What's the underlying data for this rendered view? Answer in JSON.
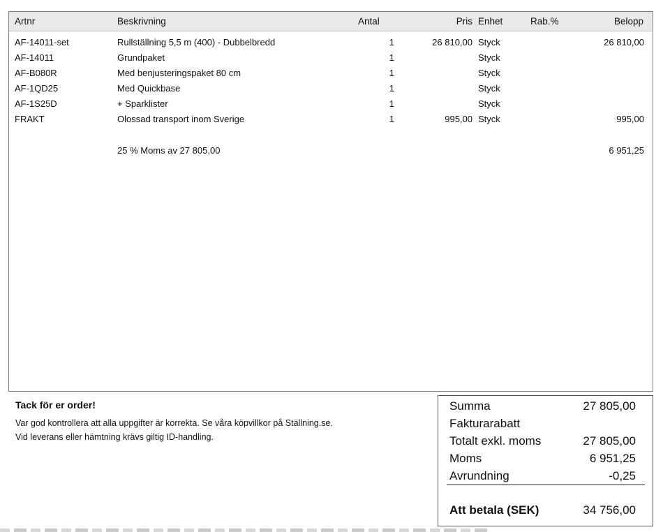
{
  "table": {
    "headers": {
      "artnr": "Artnr",
      "description": "Beskrivning",
      "quantity": "Antal",
      "price": "Pris",
      "unit": "Enhet",
      "discount": "Rab.%",
      "amount": "Belopp"
    },
    "rows": [
      {
        "artnr": "AF-14011-set",
        "description": "Rullställning 5,5 m (400) - Dubbelbredd",
        "quantity": "1",
        "price": "26 810,00",
        "unit": "Styck",
        "discount": "",
        "amount": "26 810,00"
      },
      {
        "artnr": "AF-14011",
        "description": "Grundpaket",
        "quantity": "1",
        "price": "",
        "unit": "Styck",
        "discount": "",
        "amount": ""
      },
      {
        "artnr": "AF-B080R",
        "description": "Med benjusteringspaket 80 cm",
        "quantity": "1",
        "price": "",
        "unit": "Styck",
        "discount": "",
        "amount": ""
      },
      {
        "artnr": "AF-1QD25",
        "description": "Med Quickbase",
        "quantity": "1",
        "price": "",
        "unit": "Styck",
        "discount": "",
        "amount": ""
      },
      {
        "artnr": "AF-1S25D",
        "description": "+ Sparklister",
        "quantity": "1",
        "price": "",
        "unit": "Styck",
        "discount": "",
        "amount": ""
      },
      {
        "artnr": "FRAKT",
        "description": "Olossad transport inom Sverige",
        "quantity": "1",
        "price": "995,00",
        "unit": "Styck",
        "discount": "",
        "amount": "995,00"
      }
    ],
    "vat_line": {
      "description": "25 % Moms av 27 805,00",
      "amount": "6 951,25"
    }
  },
  "message": {
    "title": "Tack för er order!",
    "lines": [
      "Var god kontrollera att alla uppgifter är korrekta. Se våra köpvillkor på Ställning.se.",
      "Vid leverans eller hämtning krävs giltig ID-handling."
    ]
  },
  "summary": {
    "rows": [
      {
        "label": "Summa",
        "value": "27 805,00"
      },
      {
        "label": "Fakturarabatt",
        "value": ""
      },
      {
        "label": "Totalt exkl. moms",
        "value": "27 805,00"
      },
      {
        "label": "Moms",
        "value": "6 951,25"
      },
      {
        "label": "Avrundning",
        "value": "-0,25"
      }
    ],
    "total": {
      "label": "Att betala (SEK)",
      "value": "34 756,00"
    }
  }
}
